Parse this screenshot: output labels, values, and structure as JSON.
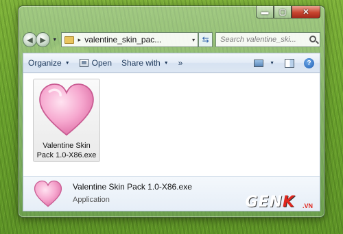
{
  "window": {
    "caption_buttons": {
      "minimize": "▬",
      "maximize": "▢",
      "close": "✕"
    }
  },
  "nav": {
    "back_icon": "back-arrow-icon",
    "forward_icon": "forward-arrow-icon"
  },
  "address": {
    "path": "valentine_skin_pac...",
    "separator": "▸",
    "dropdown": "▾"
  },
  "search": {
    "placeholder": "Search valentine_ski..."
  },
  "toolbar": {
    "organize_label": "Organize",
    "open_label": "Open",
    "share_label": "Share with",
    "more_label": "»",
    "help_label": "?"
  },
  "file": {
    "name": "Valentine Skin Pack 1.0-X86.exe",
    "icon": "heart-icon",
    "icon_color": "#f2a7cd"
  },
  "details": {
    "name": "Valentine Skin Pack 1.0-X86.exe",
    "type": "Application"
  },
  "watermark": {
    "gen": "GEN",
    "k": "K",
    "vn": ".VN"
  }
}
